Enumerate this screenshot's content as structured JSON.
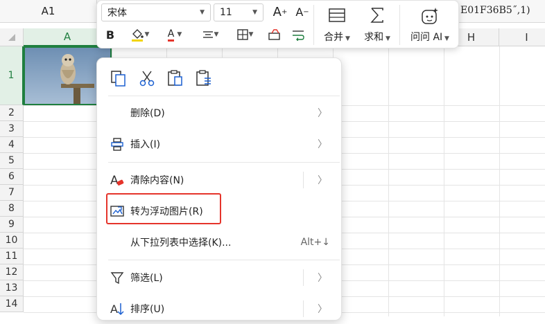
{
  "name_box": "A1",
  "formula_fragment": "E01F36B5˝,1)",
  "grid": {
    "columns": [
      {
        "label": "A",
        "selected": true
      },
      {
        "label": "H",
        "selected": false
      },
      {
        "label": "I",
        "selected": false
      }
    ],
    "rows": [
      "1",
      "2",
      "3",
      "4",
      "5",
      "6",
      "7",
      "8",
      "9",
      "10",
      "11",
      "12",
      "13",
      "14"
    ]
  },
  "toolbar": {
    "font_name": "宋体",
    "font_size": "11",
    "increase_font_label": "A",
    "decrease_font_label": "A",
    "merge_label": "合并",
    "sum_label": "求和",
    "ask_ai_label": "问问 AI",
    "bold_label": "B",
    "font_color_label": "A",
    "accent_red": "#e5342b",
    "selection_green": "#1f7f3f"
  },
  "context_menu": {
    "items": [
      {
        "label": "删除(D)",
        "icon": "none",
        "submenu": true
      },
      {
        "label": "插入(I)",
        "icon": "insert-icon",
        "submenu": true
      },
      {
        "label": "清除内容(N)",
        "icon": "clear-format-icon",
        "submenu": true
      },
      {
        "label": "转为浮动图片(R)",
        "icon": "float-picture-icon",
        "submenu": false,
        "highlighted": true
      },
      {
        "label": "从下拉列表中选择(K)...",
        "icon": "none",
        "submenu": false,
        "shortcut": "Alt+↓"
      },
      {
        "label": "筛选(L)",
        "icon": "filter-icon",
        "submenu": true
      },
      {
        "label": "排序(U)",
        "icon": "sort-icon",
        "submenu": true
      }
    ],
    "quick_actions": [
      "copy-icon",
      "cut-icon",
      "paste-icon",
      "paste-special-icon"
    ]
  }
}
